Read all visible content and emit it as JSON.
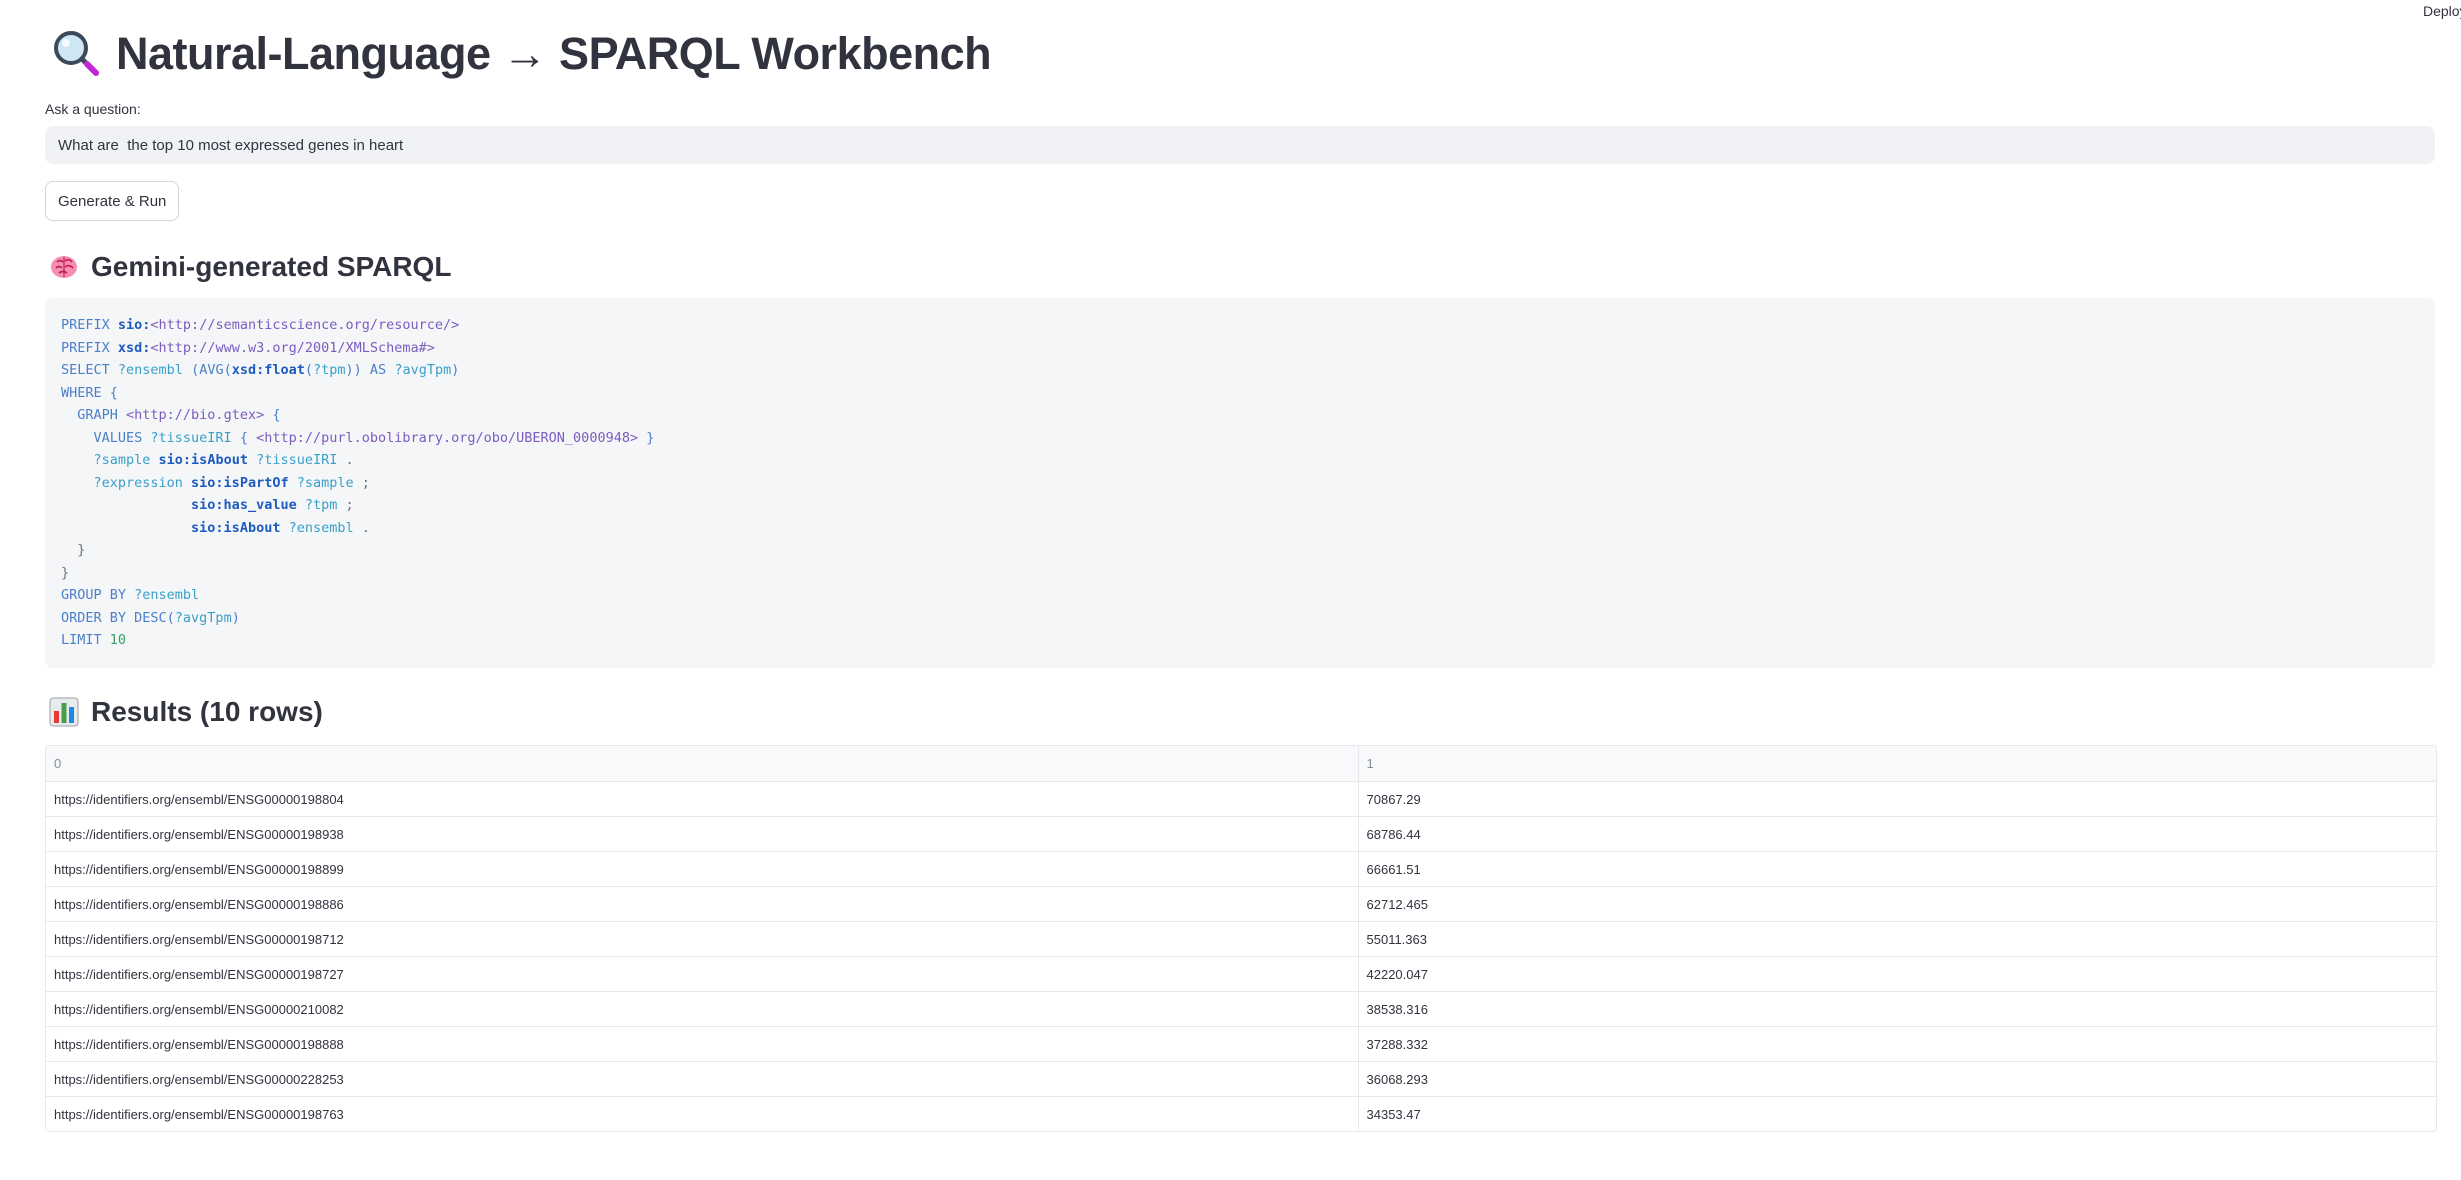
{
  "app": {
    "deploy_label": "Deploy"
  },
  "header": {
    "title": "Natural-Language → SPARQL Workbench",
    "title_icon": "magnifying-glass-icon"
  },
  "question": {
    "label": "Ask a question:",
    "value": "What are  the top 10 most expressed genes in heart"
  },
  "actions": {
    "run_label": "Generate & Run"
  },
  "sparql_section": {
    "heading": "Gemini-generated SPARQL",
    "heading_icon": "brain-icon",
    "lines": [
      "PREFIX sio:<http://semanticscience.org/resource/>",
      "PREFIX xsd:<http://www.w3.org/2001/XMLSchema#>",
      "SELECT ?ensembl (AVG(xsd:float(?tpm)) AS ?avgTpm)",
      "WHERE {",
      "  GRAPH <http://bio.gtex> {",
      "    VALUES ?tissueIRI { <http://purl.obolibrary.org/obo/UBERON_0000948> }",
      "    ?sample sio:isAbout ?tissueIRI .",
      "    ?expression sio:isPartOf ?sample ;",
      "                sio:has_value ?tpm ;",
      "                sio:isAbout ?ensembl .",
      "  }",
      "}",
      "GROUP BY ?ensembl",
      "ORDER BY DESC(?avgTpm)",
      "LIMIT 10"
    ]
  },
  "results_section": {
    "heading": "Results (10 rows)",
    "heading_icon": "bar-chart-icon",
    "columns": [
      "0",
      "1"
    ],
    "rows": [
      [
        "https://identifiers.org/ensembl/ENSG00000198804",
        "70867.29"
      ],
      [
        "https://identifiers.org/ensembl/ENSG00000198938",
        "68786.44"
      ],
      [
        "https://identifiers.org/ensembl/ENSG00000198899",
        "66661.51"
      ],
      [
        "https://identifiers.org/ensembl/ENSG00000198886",
        "62712.465"
      ],
      [
        "https://identifiers.org/ensembl/ENSG00000198712",
        "55011.363"
      ],
      [
        "https://identifiers.org/ensembl/ENSG00000198727",
        "42220.047"
      ],
      [
        "https://identifiers.org/ensembl/ENSG00000210082",
        "38538.316"
      ],
      [
        "https://identifiers.org/ensembl/ENSG00000198888",
        "37288.332"
      ],
      [
        "https://identifiers.org/ensembl/ENSG00000228253",
        "36068.293"
      ],
      [
        "https://identifiers.org/ensembl/ENSG00000198763",
        "34353.47"
      ]
    ]
  },
  "colors": {
    "text": "#31333f",
    "input_bg": "#f0f2f6",
    "code_bg": "#f5f6f8",
    "keyword": "#4b7fc9",
    "variable": "#3aa0c8",
    "uri": "#7c5cbf",
    "number": "#38a169"
  }
}
